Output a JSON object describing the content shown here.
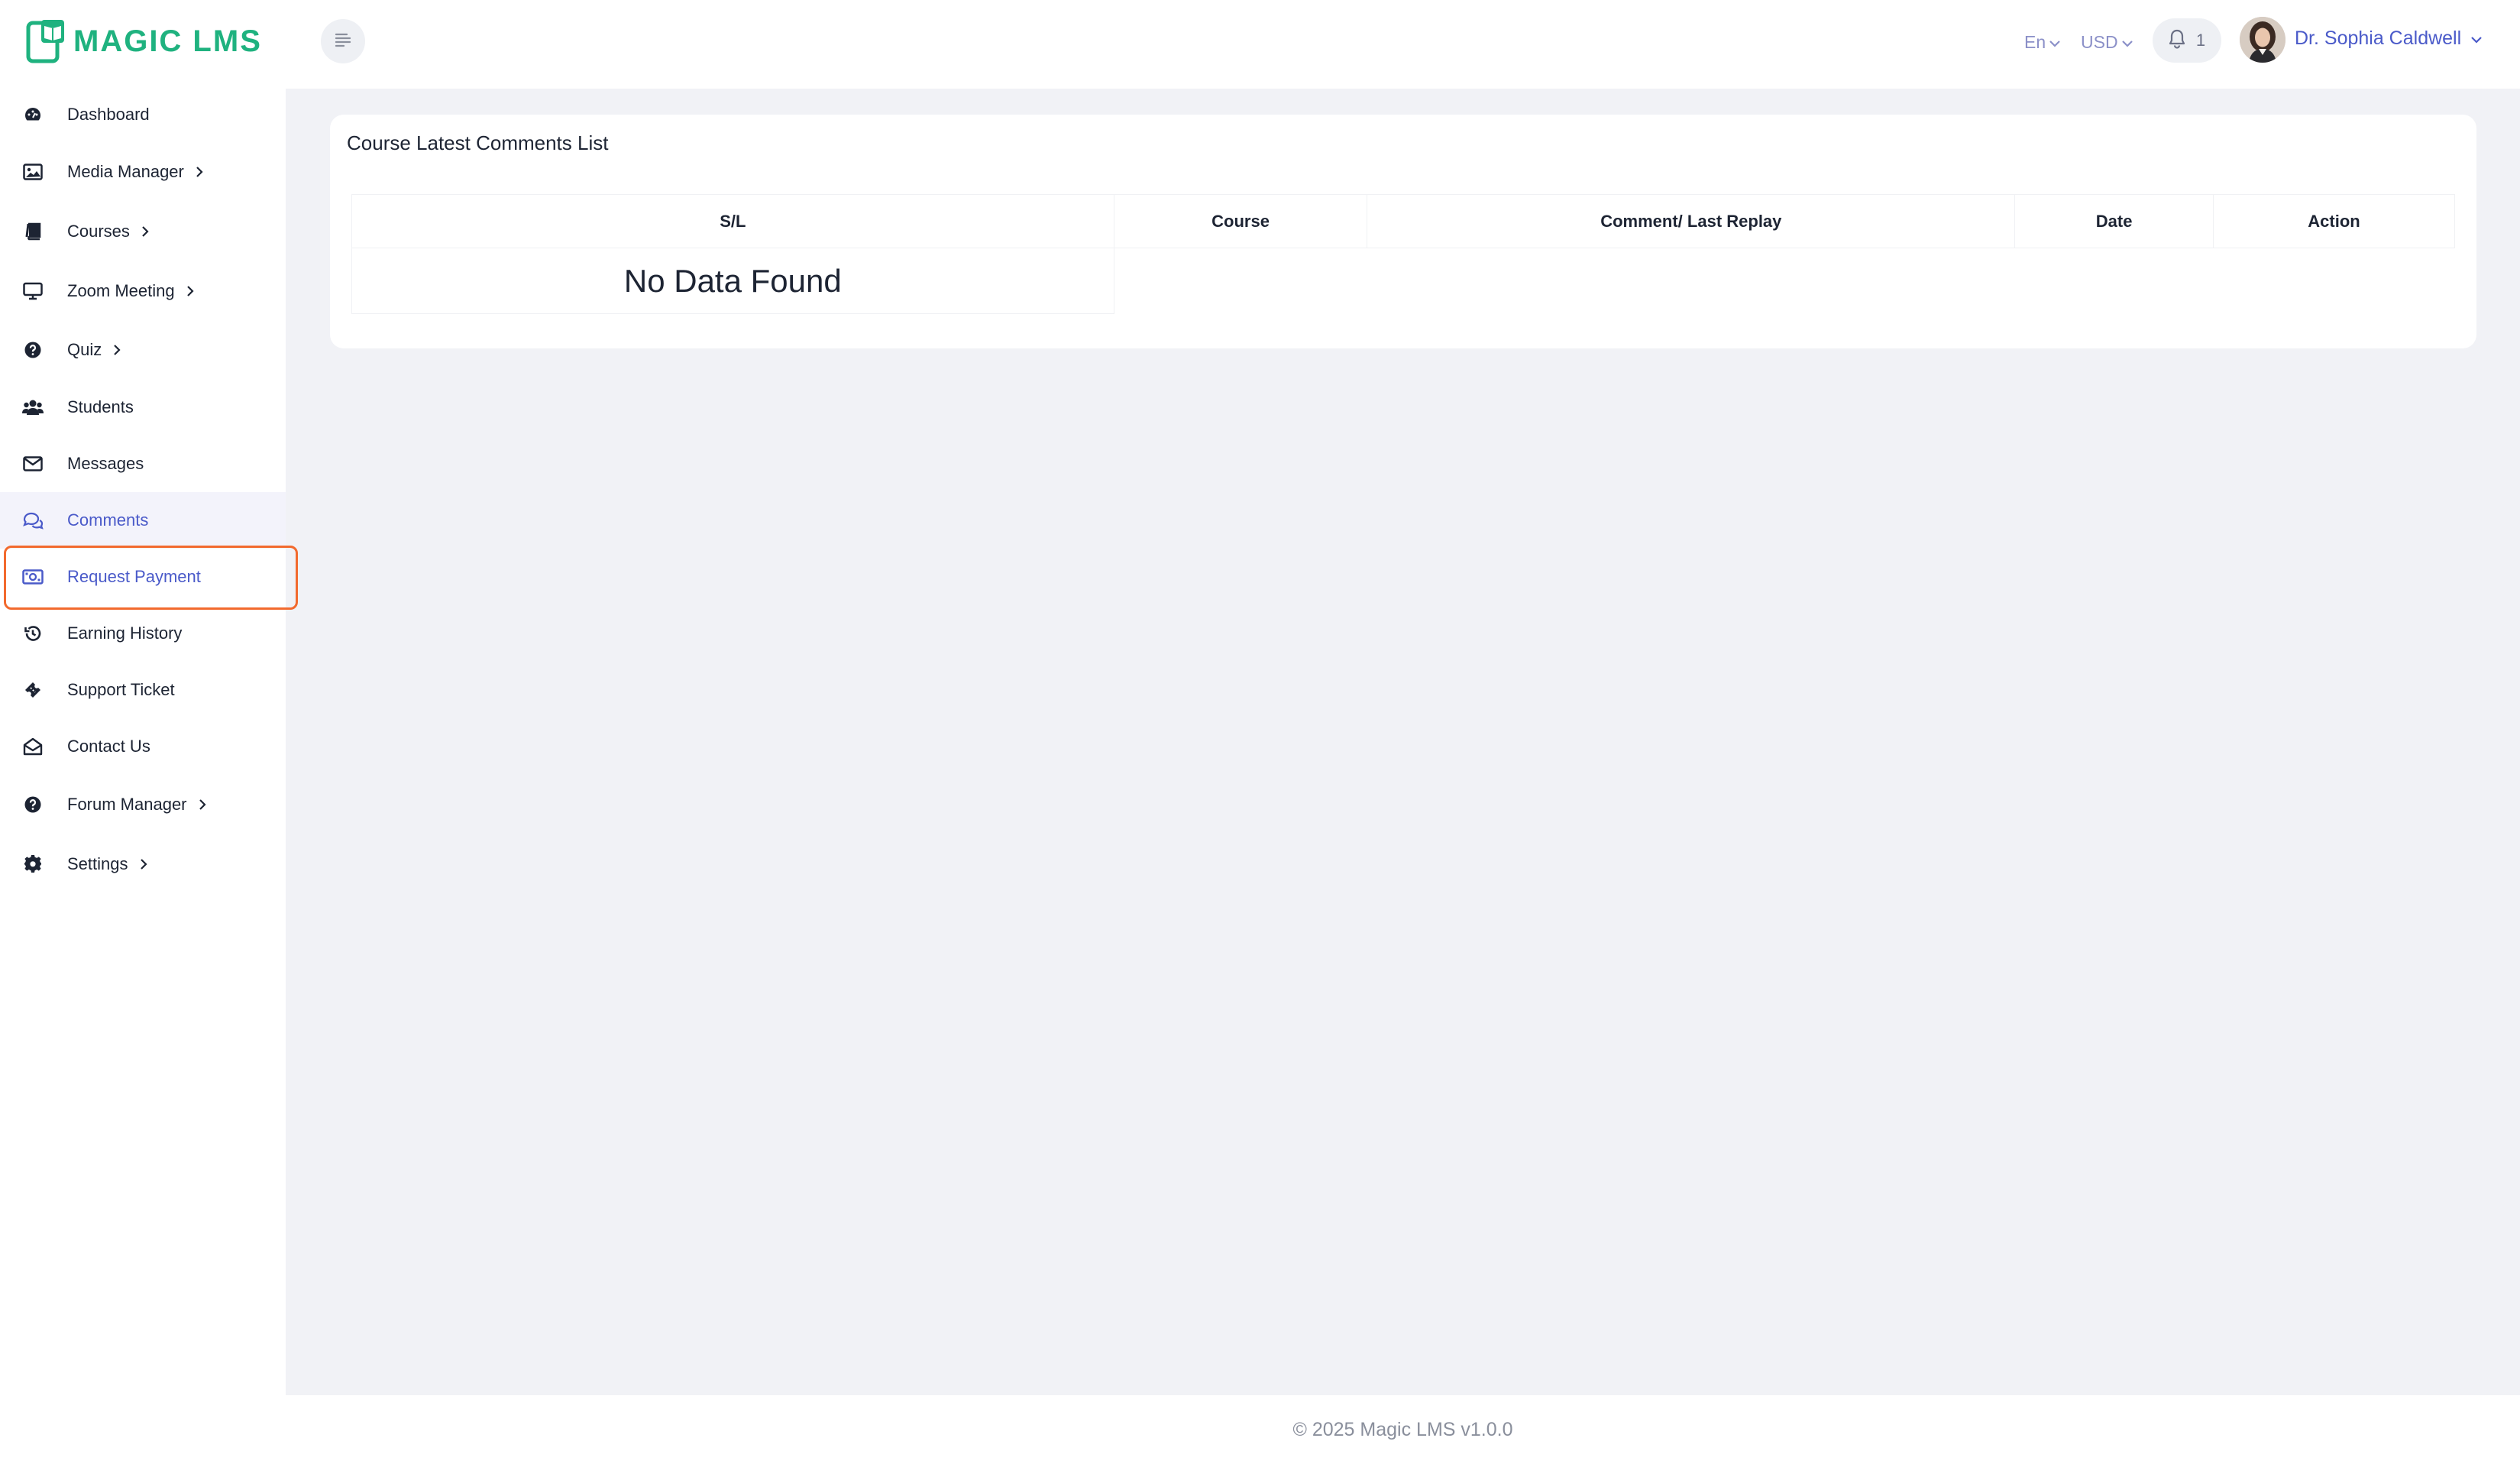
{
  "brand": {
    "logo_text": "MAGIC LMS",
    "accent": "#1fb27f"
  },
  "sidebar": {
    "items": [
      {
        "label": "Dashboard",
        "icon": "dashboard-icon",
        "has_submenu": false
      },
      {
        "label": "Media Manager",
        "icon": "image-icon",
        "has_submenu": true
      },
      {
        "label": "Courses",
        "icon": "book-icon",
        "has_submenu": true
      },
      {
        "label": "Zoom Meeting",
        "icon": "monitor-icon",
        "has_submenu": true
      },
      {
        "label": "Quiz",
        "icon": "question-icon",
        "has_submenu": true
      },
      {
        "label": "Students",
        "icon": "users-icon",
        "has_submenu": false
      },
      {
        "label": "Messages",
        "icon": "envelope-icon",
        "has_submenu": false
      },
      {
        "label": "Comments",
        "icon": "comments-icon",
        "has_submenu": false
      },
      {
        "label": "Request Payment",
        "icon": "money-icon",
        "has_submenu": false
      },
      {
        "label": "Earning History",
        "icon": "history-icon",
        "has_submenu": false
      },
      {
        "label": "Support Ticket",
        "icon": "ticket-icon",
        "has_submenu": false
      },
      {
        "label": "Contact Us",
        "icon": "envelope-open-icon",
        "has_submenu": false
      },
      {
        "label": "Forum Manager",
        "icon": "question-icon",
        "has_submenu": true
      },
      {
        "label": "Settings",
        "icon": "gear-icon",
        "has_submenu": true
      }
    ],
    "active": "Comments",
    "highlighted": "Request Payment",
    "highlight_color": "#f26a2e"
  },
  "header": {
    "language": "En",
    "currency": "USD",
    "notification_count": "1",
    "user_name": "Dr. Sophia Caldwell"
  },
  "main": {
    "card_title": "Course Latest Comments List",
    "table": {
      "columns": [
        "S/L",
        "Course",
        "Comment/ Last Replay",
        "Date",
        "Action"
      ],
      "empty_text": "No Data Found"
    }
  },
  "footer": {
    "text": "© 2025 Magic LMS v1.0.0"
  }
}
